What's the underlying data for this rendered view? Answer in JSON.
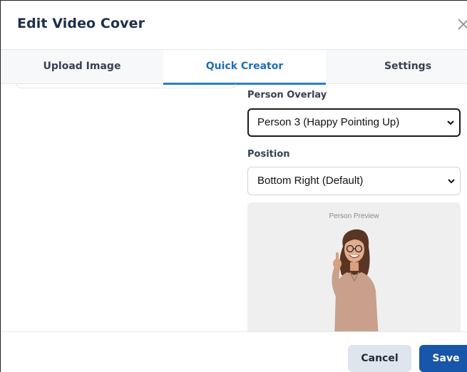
{
  "dialog": {
    "title": "Edit Video Cover"
  },
  "tabs": [
    {
      "label": "Upload Image",
      "active": false
    },
    {
      "label": "Quick Creator",
      "active": true
    },
    {
      "label": "Settings",
      "active": false
    }
  ],
  "form": {
    "person_overlay": {
      "label": "Person Overlay",
      "selected": "Person 3 (Happy Pointing Up)"
    },
    "position": {
      "label": "Position",
      "selected": "Bottom Right (Default)"
    },
    "preview": {
      "label": "Person Preview"
    }
  },
  "footer": {
    "cancel_label": "Cancel",
    "save_label": "Save"
  },
  "colors": {
    "accent": "#2b7fcf",
    "save_button": "#1756a9",
    "cancel_button": "#dfe5ec",
    "title_text": "#1d2f4e"
  },
  "icons": {
    "close": "close-icon",
    "dropdown": "chevron-down-icon"
  }
}
